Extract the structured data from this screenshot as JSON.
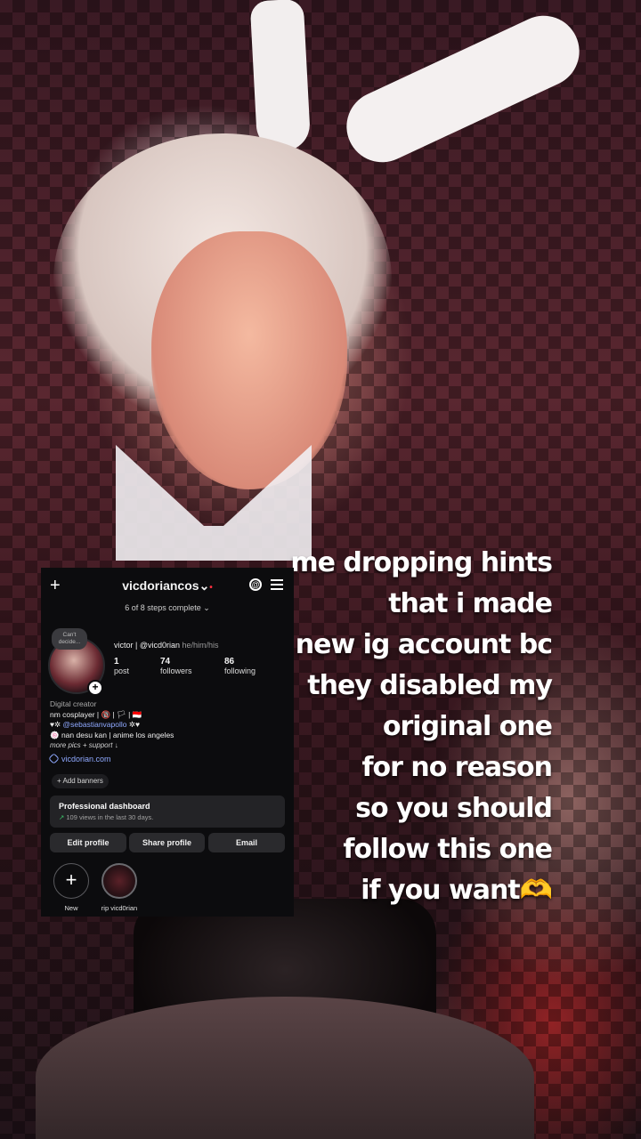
{
  "caption": {
    "lines": [
      "me dropping hints",
      "that i made",
      "a new ig account bc",
      "they disabled my",
      "original one",
      "for no reason",
      "so you should",
      "follow this one",
      "if you want🫶"
    ]
  },
  "instagram": {
    "username": "vicdoriancos",
    "username_suffix": "⌄",
    "status_dot": "•",
    "steps": "6 of 8 steps complete ⌄",
    "note": "Can't decide...",
    "display_name": "victor | @vicd0rian",
    "pronouns": "he/him/his",
    "stats": {
      "posts": {
        "num": "1",
        "label": "post"
      },
      "followers": {
        "num": "74",
        "label": "followers"
      },
      "following": {
        "num": "86",
        "label": "following"
      }
    },
    "bio": {
      "category": "Digital creator",
      "line1": "nm cosplayer | 🔞 | 🏳 | 🇮🇩",
      "line2_prefix": "♥✲ ",
      "line2_mention": "@sebastianvapollo",
      "line2_suffix": " ✲♥",
      "line3": "🍥 nan desu kan | anime los angeles",
      "line4": "more pics + support ↓"
    },
    "link": "vicdorian.com",
    "add_banners": "+ Add banners",
    "dashboard": {
      "title": "Professional dashboard",
      "arrow": "↗",
      "subtitle": "109 views in the last 30 days."
    },
    "buttons": {
      "edit": "Edit profile",
      "share": "Share profile",
      "email": "Email"
    },
    "highlights": {
      "new_symbol": "+",
      "new_label": "New",
      "rip_label": "rip vicd0rian"
    }
  },
  "colors": {
    "accent_link": "#8fa9ff",
    "notification_dot": "#ff3040",
    "growth_green": "#3cc46a"
  }
}
